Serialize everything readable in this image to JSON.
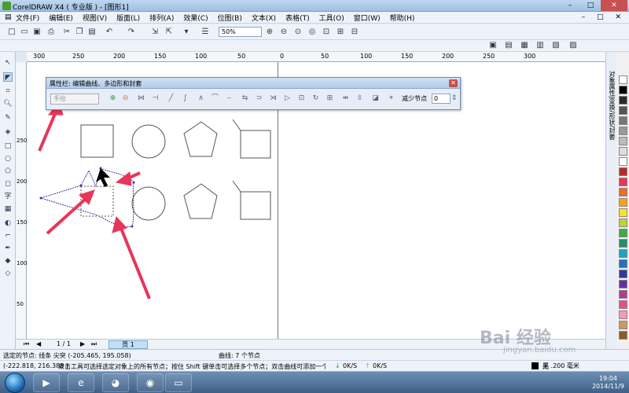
{
  "window": {
    "title": "CorelDRAW X4 ( 专业版 ) - [图形1]",
    "controls": [
      "–",
      "□",
      "✕"
    ]
  },
  "menu": {
    "items": [
      "文件(F)",
      "编辑(E)",
      "视图(V)",
      "版面(L)",
      "排列(A)",
      "效果(C)",
      "位图(B)",
      "文本(X)",
      "表格(T)",
      "工具(O)",
      "窗口(W)",
      "帮助(H)"
    ],
    "mdi_controls": "– □ ✕"
  },
  "toolbar": {
    "zoom_value": "50%"
  },
  "ruler": {
    "h_ticks": [
      "300",
      "250",
      "200",
      "150",
      "100",
      "50",
      "0",
      "50",
      "100",
      "150",
      "200",
      "250",
      "300"
    ],
    "v_ticks": [
      "250",
      "200",
      "150",
      "100",
      "50"
    ]
  },
  "property_dialog": {
    "title": "属性栏: 编辑曲线、多边形和封套",
    "mode_placeholder": "手绘",
    "reduce_nodes_label": "减少节点",
    "reduce_nodes_value": "0"
  },
  "right_docker": {
    "label": "对象属性|变换/形状/封套"
  },
  "page_bar": {
    "page_count": "1 / 1",
    "page_tab": "页 1"
  },
  "status": {
    "selected_node": "选定的节点: 线条 尖突 (-205.465, 195.058)",
    "curve_info": "曲线: 7 个节点",
    "coords": "(-222.818, 216.388 )",
    "hint": "双击工具可选择选定对象上的所有节点；按住 Shift 键单击可选择多个节点；双击曲线可添加一个节点；",
    "net_down": "0K/S",
    "net_up": "0K/S",
    "fill_label": "无",
    "outline_label": "黑 .200 毫米"
  },
  "taskbar": {
    "time": "19:04",
    "date": "2014/11/9"
  },
  "watermark": {
    "text": "Bai 经验",
    "url": "jingyan.baidu.com"
  },
  "colors": {
    "arrow": "#e8365a",
    "shape_stroke": "#555555",
    "edit_stroke": "#3a3aa8",
    "palette": [
      "#ffffff",
      "#000000",
      "#2b2b2b",
      "#555555",
      "#777777",
      "#999999",
      "#bbbbbb",
      "#dddddd",
      "#ffffff",
      "#b52a2a",
      "#e8365a",
      "#f26b2a",
      "#f7a21b",
      "#ffe12a",
      "#b6d63a",
      "#3fa846",
      "#20906a",
      "#1ea3c8",
      "#2670c2",
      "#2d3aa0",
      "#6a2f9b",
      "#b03a9a",
      "#e84e8a",
      "#f39ab6",
      "#c79a6a",
      "#8b5a2b"
    ]
  }
}
